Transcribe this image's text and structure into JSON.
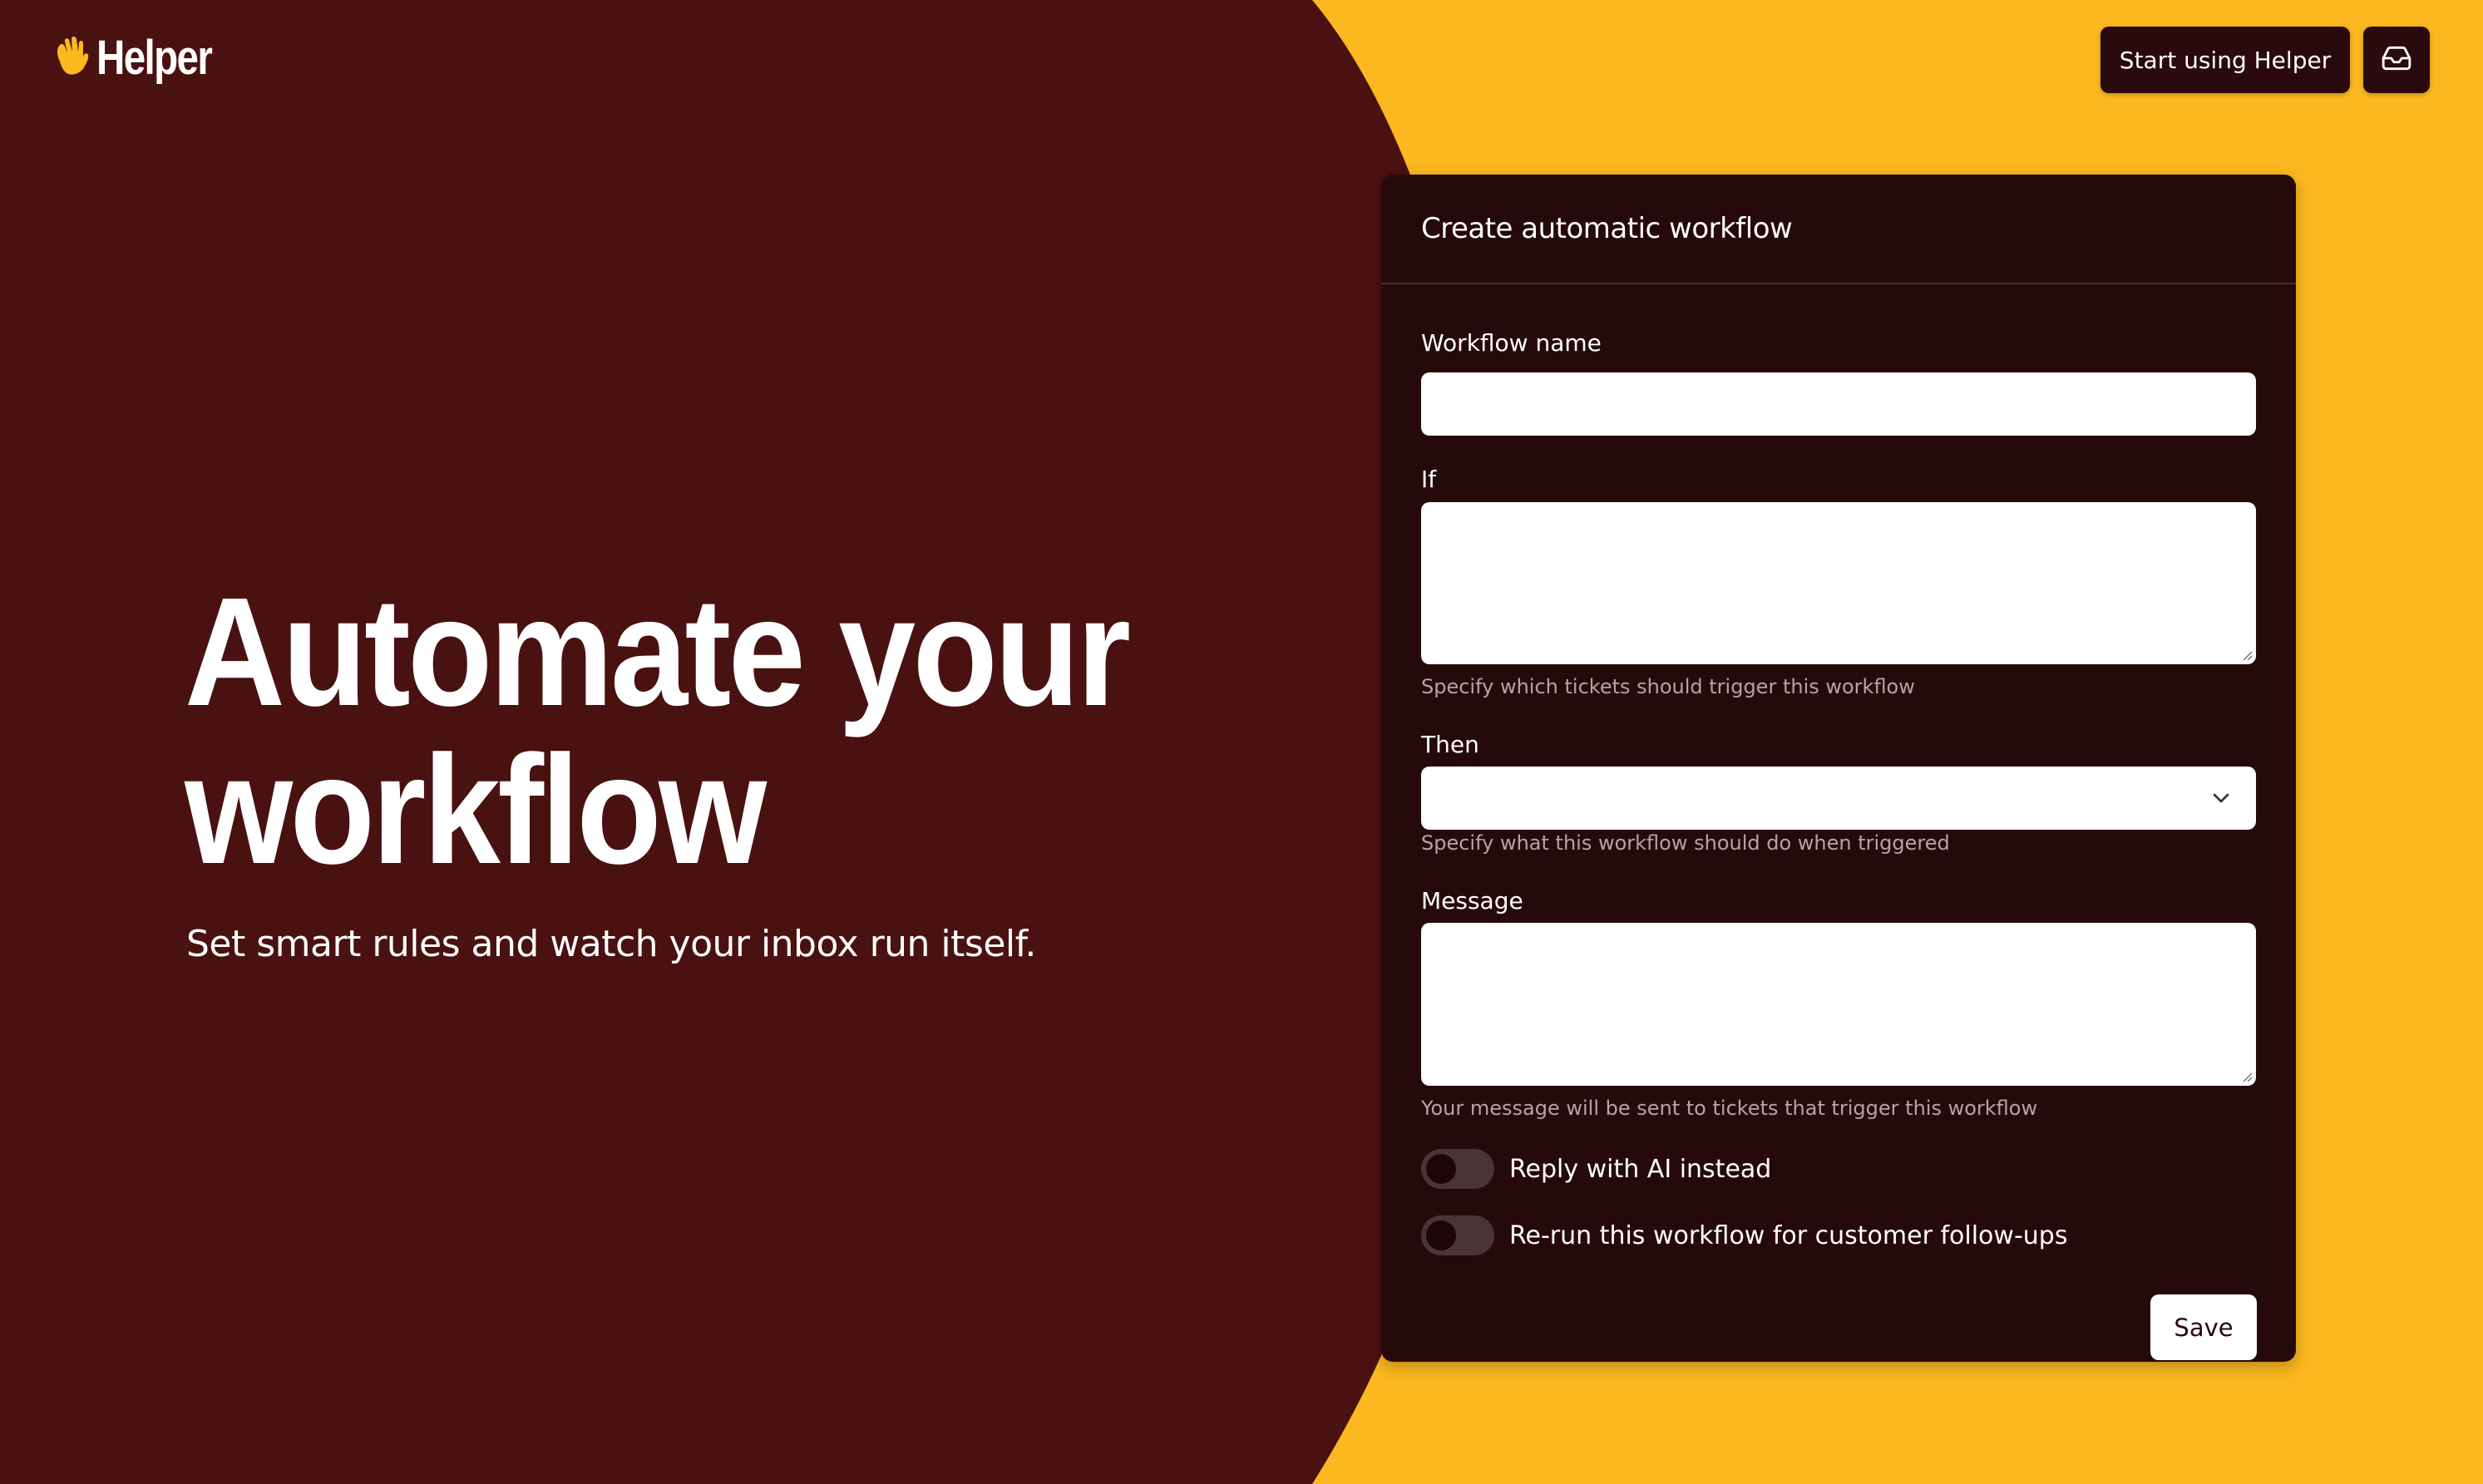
{
  "brand": {
    "name": "Helper",
    "logo_icon": "waving-hand-icon",
    "colors": {
      "background_dark": "#4a1111",
      "accent_yellow": "#fbb81f",
      "card": "#260a0b"
    }
  },
  "header": {
    "cta_label": "Start using Helper",
    "inbox_icon": "inbox-icon"
  },
  "hero": {
    "title_line1": "Automate your",
    "title_line2": "workflow",
    "subtitle": "Set smart rules and watch your inbox run itself."
  },
  "form": {
    "title": "Create automatic workflow",
    "workflow_name": {
      "label": "Workflow name",
      "value": ""
    },
    "if": {
      "label": "If",
      "value": "",
      "hint": "Specify which tickets should trigger this workflow"
    },
    "then": {
      "label": "Then",
      "value": "",
      "hint": "Specify what this workflow should do when triggered"
    },
    "message": {
      "label": "Message",
      "value": "",
      "hint": "Your message will be sent to tickets that trigger this workflow"
    },
    "toggles": [
      {
        "label": "Reply with AI instead",
        "on": false
      },
      {
        "label": "Re-run this workflow for customer follow-ups",
        "on": false
      }
    ],
    "save_label": "Save"
  }
}
